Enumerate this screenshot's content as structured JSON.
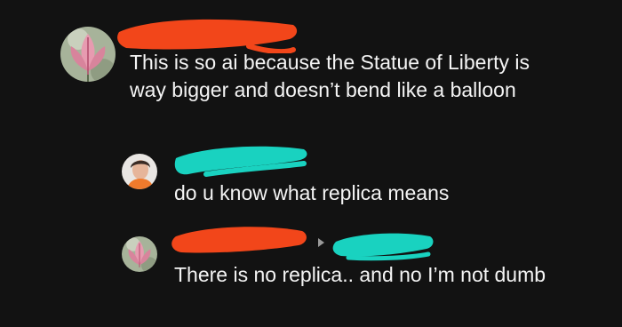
{
  "colors": {
    "background": "#121212",
    "text": "#f4f4f4",
    "redact_orange": "#f2461a",
    "redact_teal": "#19d2c0"
  },
  "thread": {
    "comment1": {
      "avatar_icon": "flower-avatar-icon",
      "username": "",
      "text": "This is so ai because the Statue of Liberty is way bigger and doesn’t bend like a balloon"
    },
    "reply1": {
      "avatar_icon": "person-avatar-icon",
      "username": "",
      "text": "do u know what replica means"
    },
    "reply2": {
      "avatar_icon": "flower-avatar-icon",
      "username": "",
      "reply_to_icon": "reply-arrow-icon",
      "reply_to": "",
      "text": "There is no replica.. and no I’m not dumb"
    }
  }
}
